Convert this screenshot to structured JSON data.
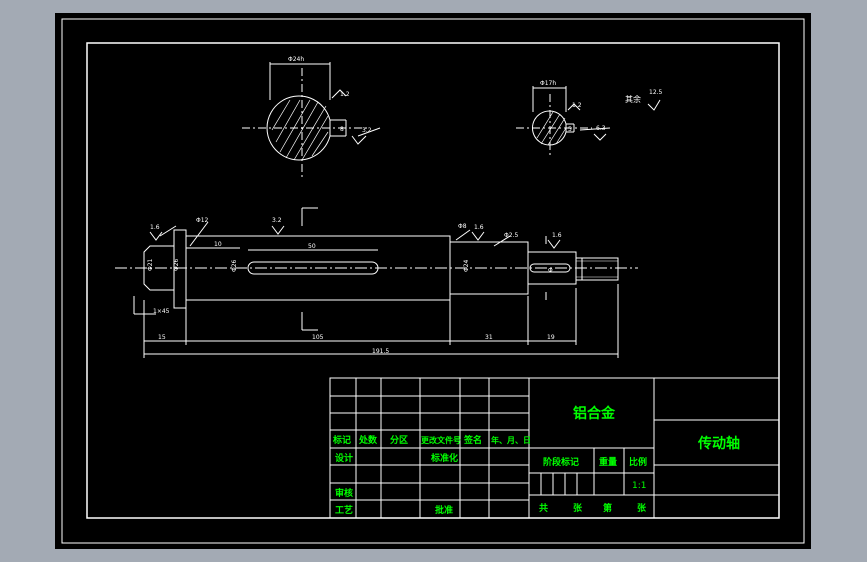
{
  "dimensions": {
    "section_a_width": "Φ24h",
    "section_a_key": "8",
    "section_b_width": "Φ17h",
    "section_b_key": "5",
    "dia_left_small": "Φ21",
    "dia_collar": "Φ26",
    "dia_main": "Φ26",
    "dia_right": "Φ24",
    "dia_end": "Φ",
    "chamfer_a": "Φ12",
    "chamfer_b": "Φ8",
    "chamfer_c": "Φ2.5",
    "key_length": "50",
    "len_left": "15",
    "len_middle": "105",
    "len_right": "31",
    "len_end": "19",
    "len_total": "191.5",
    "len_collar": "10",
    "bevel": "1×45"
  },
  "roughness": {
    "section_a_top": "1.2",
    "section_a_bottom": "3.2",
    "section_b_top": "1.2",
    "section_b_bottom": "6.3",
    "general": "其余",
    "general_value": "12.5",
    "left_end": "1.6",
    "keyway": "3.2",
    "shoulder_right": "1.6",
    "right_end": "1.6"
  },
  "title_block": {
    "material": "铝合金",
    "part_name": "传动轴",
    "headers": [
      "标记",
      "处数",
      "分区",
      "更改文件号",
      "签名",
      "年、月、日"
    ],
    "design": "设计",
    "standardize": "标准化",
    "review": "审核",
    "process": "工艺",
    "approve": "批准",
    "stage_mark": "阶段标记",
    "weight": "重量",
    "scale_label": "比例",
    "scale_value": "1:1",
    "total": "共",
    "sheets1": "张",
    "page": "第",
    "sheets2": "张"
  },
  "colors": {
    "outer_bg": "#a3aab4",
    "sheet_bg": "#000000",
    "line": "#ffffff",
    "text_green": "#00ff00"
  }
}
